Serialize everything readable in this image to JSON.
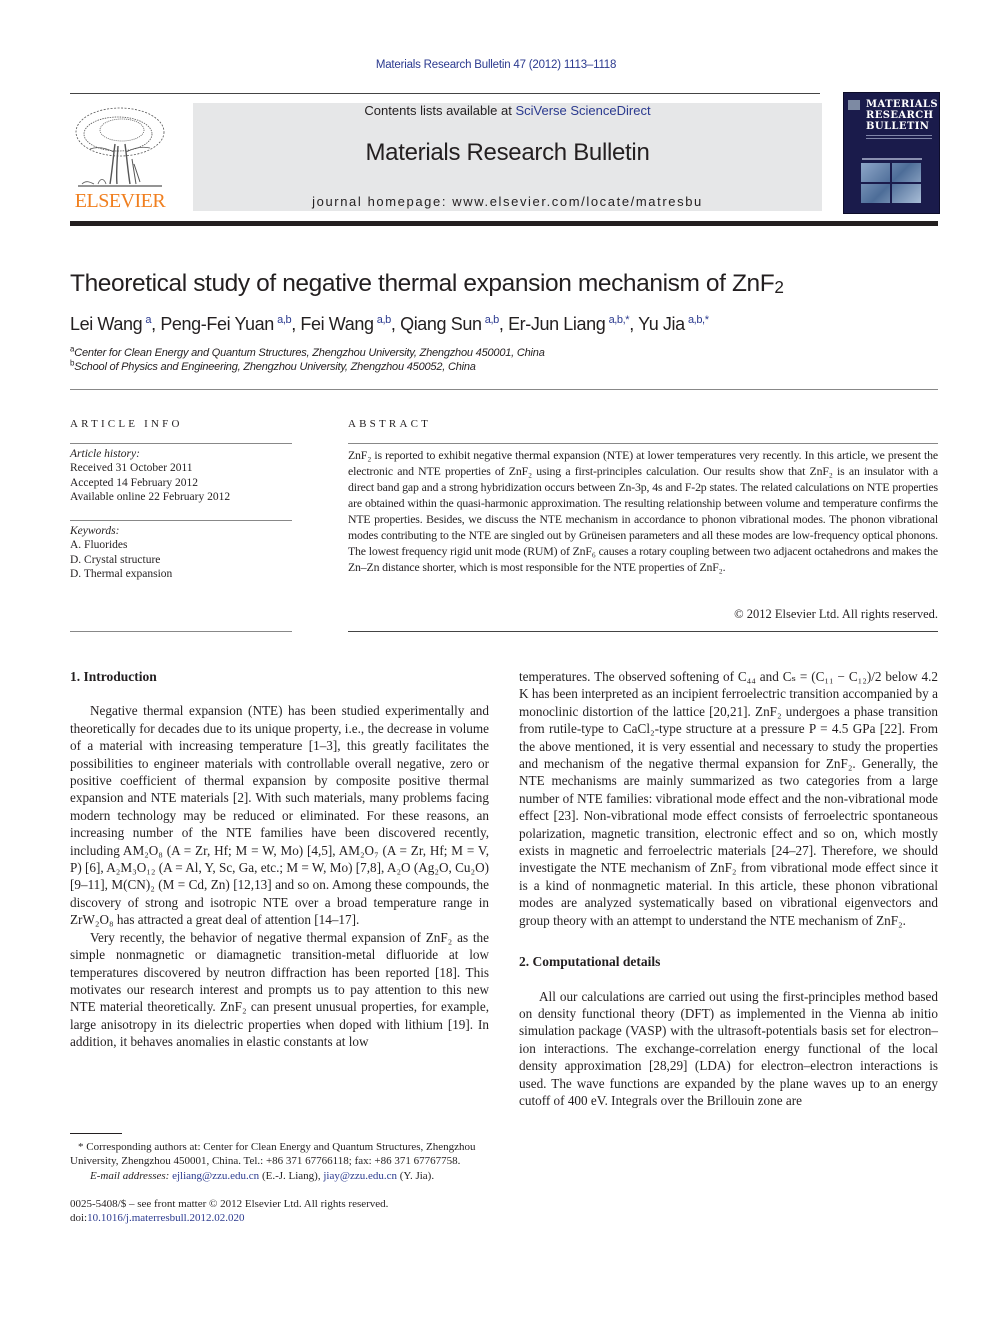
{
  "header": {
    "citation": "Materials Research Bulletin 47 (2012) 1113–1118",
    "contents_prefix": "Contents lists available at ",
    "contents_link": "SciVerse ScienceDirect",
    "journal_title": "Materials Research Bulletin",
    "homepage": "journal homepage: www.elsevier.com/locate/matresbu",
    "publisher_wordmark": "ELSEVIER",
    "cover_title_lines": [
      "MATERIALS",
      "RESEARCH",
      "BULLETIN"
    ]
  },
  "article": {
    "title": "Theoretical study of negative thermal expansion mechanism of ZnF",
    "title_sub": "2",
    "authors": [
      {
        "name": "Lei Wang",
        "aff": "a"
      },
      {
        "name": "Peng-Fei Yuan",
        "aff": "a,b"
      },
      {
        "name": "Fei Wang",
        "aff": "a,b"
      },
      {
        "name": "Qiang Sun",
        "aff": "a,b"
      },
      {
        "name": "Er-Jun Liang",
        "aff": "a,b,*"
      },
      {
        "name": "Yu Jia",
        "aff": "a,b,*"
      }
    ],
    "affiliations": [
      {
        "mark": "a",
        "text": "Center for Clean Energy and Quantum Structures, Zhengzhou University, Zhengzhou 450001, China"
      },
      {
        "mark": "b",
        "text": "School of Physics and Engineering, Zhengzhou University, Zhengzhou 450052, China"
      }
    ]
  },
  "article_info": {
    "heading": "ARTICLE INFO",
    "history_label": "Article history:",
    "history": [
      "Received 31 October 2011",
      "Accepted 14 February 2012",
      "Available online 22 February 2012"
    ],
    "keywords_label": "Keywords:",
    "keywords": [
      "A. Fluorides",
      "D. Crystal structure",
      "D. Thermal expansion"
    ]
  },
  "abstract": {
    "heading": "ABSTRACT",
    "text": "ZnF₂ is reported to exhibit negative thermal expansion (NTE) at lower temperatures very recently. In this article, we present the electronic and NTE properties of ZnF₂ using a first-principles calculation. Our results show that ZnF₂ is an insulator with a direct band gap and a strong hybridization occurs between Zn-3p, 4s and F-2p states. The related calculations on NTE properties are obtained within the quasi-harmonic approximation. The resulting relationship between volume and temperature confirms the NTE properties. Besides, we discuss the NTE mechanism in accordance to phonon vibrational modes. The phonon vibrational modes contributing to the NTE are singled out by Grüneisen parameters and all these modes are low-frequency optical phonons. The lowest frequency rigid unit mode (RUM) of ZnF₆ causes a rotary coupling between two adjacent octahedrons and makes the Zn–Zn distance shorter, which is most responsible for the NTE properties of ZnF₂.",
    "copyright": "© 2012 Elsevier Ltd. All rights reserved."
  },
  "body": {
    "section1_heading": "1.  Introduction",
    "section1_paragraphs": [
      "Negative thermal expansion (NTE) has been studied experimentally and theoretically for decades due to its unique property, i.e., the decrease in volume of a material with increasing temperature [1–3], this greatly facilitates the possibilities to engineer materials with controllable overall negative, zero or positive coefficient of thermal expansion by composite positive thermal expansion and NTE materials [2]. With such materials, many problems facing modern technology may be reduced or eliminated. For these reasons, an increasing number of the NTE families have been discovered recently, including AM₂O₈ (A = Zr, Hf; M = W, Mo) [4,5], AM₂O₇ (A = Zr, Hf; M = V, P) [6], A₂M₃O₁₂ (A = Al, Y, Sc, Ga, etc.; M = W, Mo) [7,8], A₂O (Ag₂O, Cu₂O) [9–11], M(CN)₂ (M = Cd, Zn) [12,13] and so on. Among these compounds, the discovery of strong and isotropic NTE over a broad temperature range in ZrW₂O₈ has attracted a great deal of attention [14–17].",
      "Very recently, the behavior of negative thermal expansion of ZnF₂ as the simple nonmagnetic or diamagnetic transition-metal difluoride at low temperatures discovered by neutron diffraction has been reported [18]. This motivates our research interest and prompts us to pay attention to this new NTE material theoretically. ZnF₂ can present unusual properties, for example, large anisotropy in its dielectric properties when doped with lithium [19]. In addition, it behaves anomalies in elastic constants at low"
    ],
    "right_col_continuation": "temperatures. The observed softening of C₄₄ and Cₛ = (C₁₁ − C₁₂)/2 below 4.2 K has been interpreted as an incipient ferroelectric transition accompanied by a monoclinic distortion of the lattice [20,21]. ZnF₂ undergoes a phase transition from rutile-type to CaCl₂-type structure at a pressure P = 4.5 GPa [22]. From the above mentioned, it is very essential and necessary to study the properties and mechanism of the negative thermal expansion for ZnF₂. Generally, the NTE mechanisms are mainly summarized as two categories from a large number of NTE families: vibrational mode effect and the non-vibrational mode effect [23]. Non-vibrational mode effect consists of ferroelectric spontaneous polarization, magnetic transition, electronic effect and so on, which mostly exists in magnetic and ferroelectric materials [24–27]. Therefore, we should investigate the NTE mechanism of ZnF₂ from vibrational mode effect since it is a kind of nonmagnetic material. In this article, these phonon vibrational modes are analyzed systematically based on vibrational eigenvectors and group theory with an attempt to understand the NTE mechanism of ZnF₂.",
    "section2_heading": "2.  Computational details",
    "section2_paragraph": "All our calculations are carried out using the first-principles method based on density functional theory (DFT) as implemented in the Vienna ab initio simulation package (VASP) with the ultrasoft-potentials basis set for electron–ion interactions. The exchange-correlation energy functional of the local density approximation [28,29] (LDA) for electron–electron interactions is used. The wave functions are expanded by the plane waves up to an energy cutoff of 400 eV. Integrals over the Brillouin zone are"
  },
  "footnote": {
    "corresponding": "* Corresponding authors at: Center for Clean Energy and Quantum Structures, Zhengzhou University, Zhengzhou 450001, China. Tel.: +86 371 67766118; fax: +86 371 67767758.",
    "email_label": "E-mail addresses: ",
    "email1": "ejliang@zzu.edu.cn",
    "email1_owner": " (E.-J. Liang), ",
    "email2": "jiay@zzu.edu.cn",
    "email2_owner": " (Y. Jia).",
    "front_matter": "0025-5408/$ – see front matter © 2012 Elsevier Ltd. All rights reserved.",
    "doi_label": "doi:",
    "doi": "10.1016/j.materresbull.2012.02.020"
  },
  "colors": {
    "link": "#2b3a8f",
    "elsevier_orange": "#f07f1f",
    "header_box": "#e6e7e8",
    "cover_navy": "#1a1b4b"
  }
}
